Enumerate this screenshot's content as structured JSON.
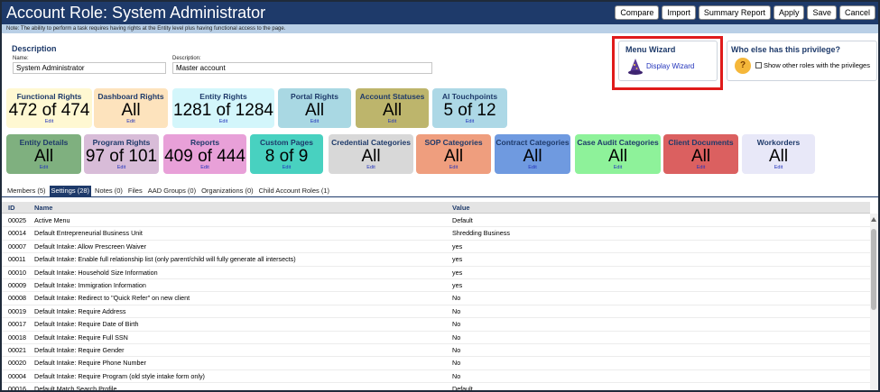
{
  "title": "Account Role: System Administrator",
  "toolbar": [
    "Compare",
    "Import",
    "Summary Report",
    "Apply",
    "Save",
    "Cancel"
  ],
  "note": "Note: The ability to perform a task requires having rights at the Entity level plus having functional access to the page.",
  "description": {
    "title": "Description",
    "name_label": "Name:",
    "name_value": "System Administrator",
    "desc_label": "Description:",
    "desc_value": "Master account"
  },
  "wizard": {
    "title": "Menu Wizard",
    "link": "Display Wizard",
    "highlight_color": "#e01b1b",
    "icon": "wizard-hat-icon"
  },
  "who": {
    "title": "Who else has this privilege?",
    "checkbox_label": "Show other roles with the privileges",
    "checked": false,
    "icon": "question-icon"
  },
  "tiles_row1": [
    {
      "label": "Functional Rights",
      "value": "472 of 474",
      "edit": "Edit",
      "color": "#fff8d2"
    },
    {
      "label": "Dashboard Rights",
      "value": "All",
      "edit": "Edit",
      "color": "#fde3bd"
    },
    {
      "label": "Entity Rights",
      "value": "1281 of 1284",
      "edit": "Edit",
      "color": "#d3f6fb"
    },
    {
      "label": "Portal Rights",
      "value": "All",
      "edit": "Edit",
      "color": "#a9d8e3"
    },
    {
      "label": "Account Statuses",
      "value": "All",
      "edit": "Edit",
      "color": "#bdb56c"
    },
    {
      "label": "AI Touchpoints",
      "value": "5 of 12",
      "edit": "Edit",
      "color": "#add8e6"
    }
  ],
  "tiles_row2": [
    {
      "label": "Entity Details",
      "value": "All",
      "edit": "Edit",
      "color": "#7fb07f"
    },
    {
      "label": "Program Rights",
      "value": "97 of 101",
      "edit": "Edit",
      "color": "#d8bcd8"
    },
    {
      "label": "Reports",
      "value": "409 of 444",
      "edit": "Edit",
      "color": "#e8a0d8"
    },
    {
      "label": "Custom Pages",
      "value": "8 of 9",
      "edit": "Edit",
      "color": "#48d1c0"
    },
    {
      "label": "Credential Categories",
      "value": "All",
      "edit": "Edit",
      "color": "#d8d8d8"
    },
    {
      "label": "SOP Categories",
      "value": "All",
      "edit": "Edit",
      "color": "#ef9e7e"
    },
    {
      "label": "Contract Categories",
      "value": "All",
      "edit": "Edit",
      "color": "#6f9ae0"
    },
    {
      "label": "Case Audit Categories",
      "value": "All",
      "edit": "Edit",
      "color": "#8ef29a"
    },
    {
      "label": "Client Documents",
      "value": "All",
      "edit": "Edit",
      "color": "#db6060"
    },
    {
      "label": "Workorders",
      "value": "All",
      "edit": "Edit",
      "color": "#e8e8f8"
    }
  ],
  "tabs": [
    "Members (5)",
    "Settings (28)",
    "Notes (0)",
    "Files",
    "AAD Groups (0)",
    "Organizations (0)",
    "Child Account Roles (1)"
  ],
  "active_tab": "Settings (28)",
  "table": {
    "columns": [
      "ID",
      "Name",
      "Value"
    ],
    "rows": [
      [
        "00025",
        "Active Menu",
        "Default"
      ],
      [
        "00014",
        "Default Entrepreneurial Business Unit",
        "Shredding Business"
      ],
      [
        "00007",
        "Default Intake: Allow Prescreen Waiver",
        "yes"
      ],
      [
        "00011",
        "Default Intake: Enable full relationship list (only parent/child will fully generate all intersects)",
        "yes"
      ],
      [
        "00010",
        "Default Intake: Household Size Information",
        "yes"
      ],
      [
        "00009",
        "Default Intake: Immigration Information",
        "yes"
      ],
      [
        "00008",
        "Default Intake: Redirect to \"Quick Refer\" on new client",
        "No"
      ],
      [
        "00019",
        "Default Intake: Require Address",
        "No"
      ],
      [
        "00017",
        "Default Intake: Require Date of Birth",
        "No"
      ],
      [
        "00018",
        "Default Intake: Require Full SSN",
        "No"
      ],
      [
        "00021",
        "Default Intake: Require Gender",
        "No"
      ],
      [
        "00020",
        "Default Intake: Require Phone Number",
        "No"
      ],
      [
        "00004",
        "Default Intake: Require Program (old style intake form only)",
        "No"
      ],
      [
        "00016",
        "Default Match Search Profile",
        "Default"
      ]
    ]
  }
}
